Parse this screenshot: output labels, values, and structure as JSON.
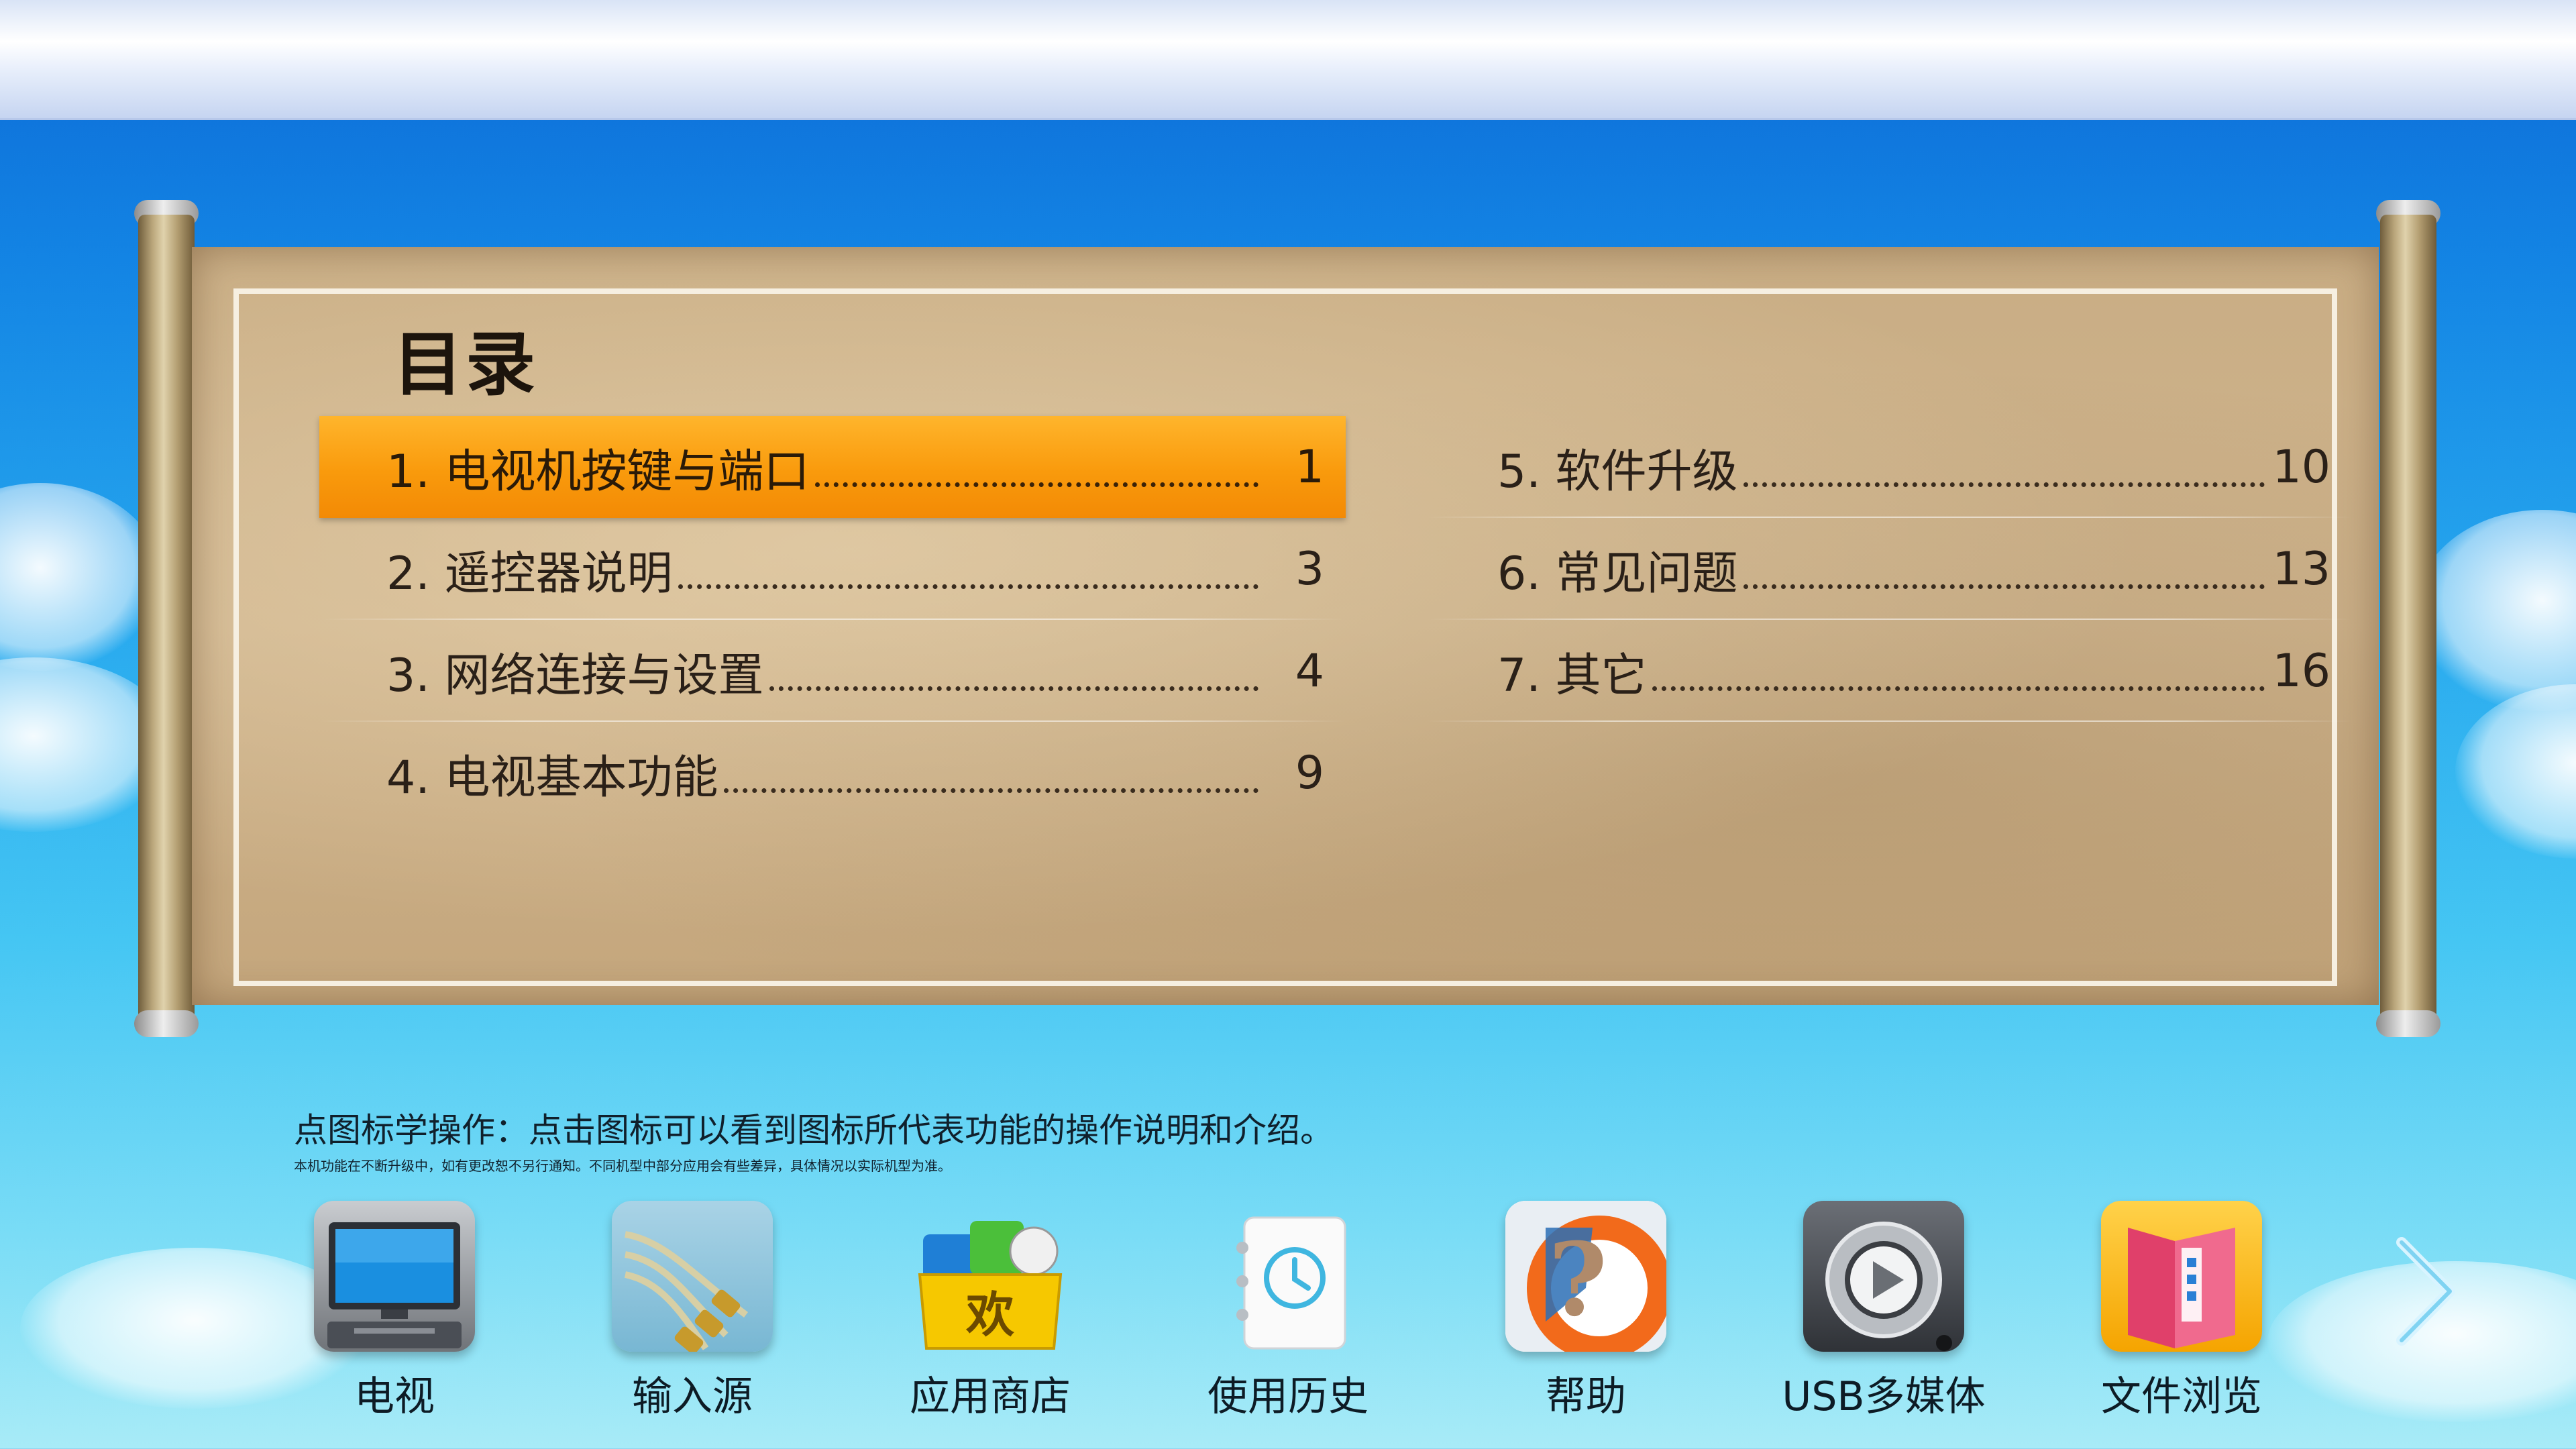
{
  "toc": {
    "title": "目录",
    "entries": [
      {
        "label": "1. 电视机按键与端口",
        "page": "1",
        "selected": true
      },
      {
        "label": "2. 遥控器说明",
        "page": "3",
        "selected": false
      },
      {
        "label": "3. 网络连接与设置",
        "page": "4",
        "selected": false
      },
      {
        "label": "4. 电视基本功能",
        "page": "9",
        "selected": false
      },
      {
        "label": "5. 软件升级",
        "page": "10",
        "selected": false
      },
      {
        "label": "6. 常见问题",
        "page": "13",
        "selected": false
      },
      {
        "label": "7. 其它",
        "page": "16",
        "selected": false
      }
    ]
  },
  "hint": {
    "main": "点图标学操作：点击图标可以看到图标所代表功能的操作说明和介绍。",
    "sub": "本机功能在不断升级中，如有更改恕不另行通知。不同机型中部分应用会有些差异，具体情况以实际机型为准。"
  },
  "dock": {
    "items": [
      {
        "label": "电视",
        "icon": "tv-icon"
      },
      {
        "label": "输入源",
        "icon": "av-cable-icon"
      },
      {
        "label": "应用商店",
        "icon": "app-store-icon"
      },
      {
        "label": "使用历史",
        "icon": "history-clock-icon"
      },
      {
        "label": "帮助",
        "icon": "help-question-icon"
      },
      {
        "label": "USB多媒体",
        "icon": "usb-media-play-icon"
      },
      {
        "label": "文件浏览",
        "icon": "file-folder-icon"
      }
    ],
    "next": "chevron-right-icon"
  },
  "colors": {
    "selected_row": "#f99a0c",
    "paper": "#c9ad84",
    "sky_top": "#0c6ad6",
    "sky_bottom": "#a8ebf7"
  }
}
